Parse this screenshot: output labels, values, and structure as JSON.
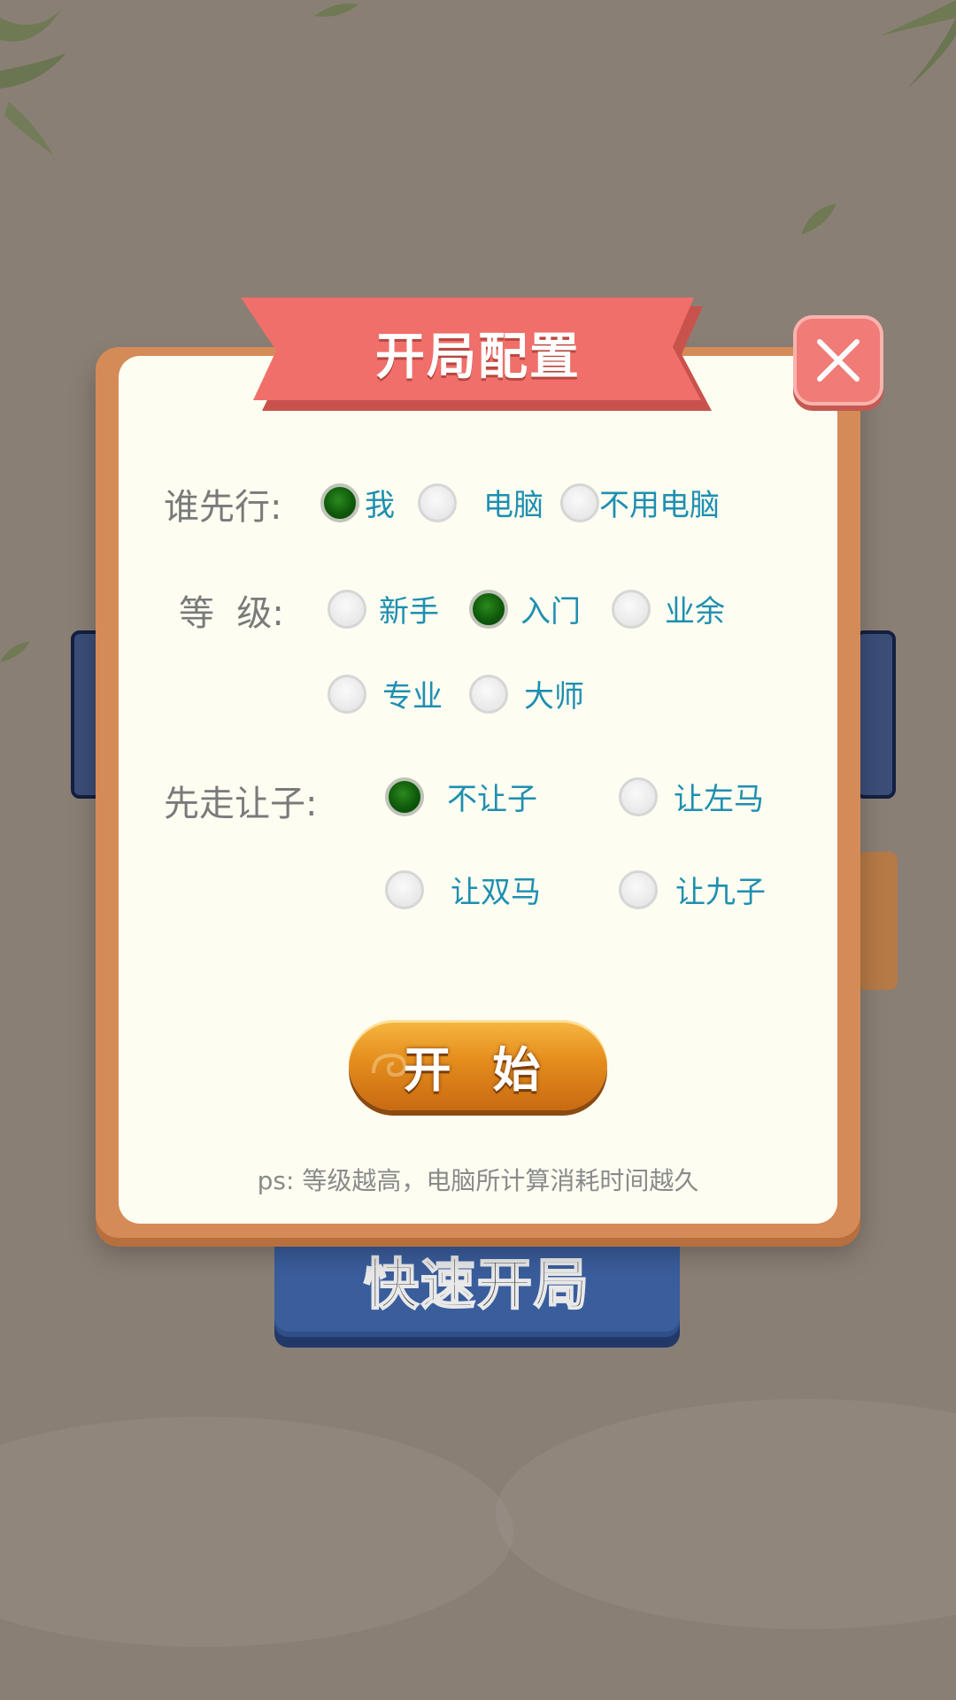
{
  "background": {
    "quick_start_label": "快速开局"
  },
  "dialog": {
    "title": "开局配置",
    "first_move": {
      "label": "谁先行:",
      "options": [
        "我",
        "电脑",
        "不用电脑"
      ],
      "selected": "我"
    },
    "level": {
      "label": "等  级:",
      "options": [
        "新手",
        "入门",
        "业余",
        "专业",
        "大师"
      ],
      "selected": "入门"
    },
    "handicap": {
      "label": "先走让子:",
      "options": [
        "不让子",
        "让左马",
        "让双马",
        "让九子"
      ],
      "selected": "不让子"
    },
    "start_label": "开 始",
    "note": "ps: 等级越高，电脑所计算消耗时间越久"
  },
  "colors": {
    "dialog_border": "#d58b57",
    "dialog_fill": "#fdfdf2",
    "ribbon": "#f07370",
    "option_text": "#1e8fb1",
    "selected_radio": "#0f5a0b",
    "start_button": "#e48d1d"
  },
  "icons": {
    "close": "close-x-icon"
  }
}
